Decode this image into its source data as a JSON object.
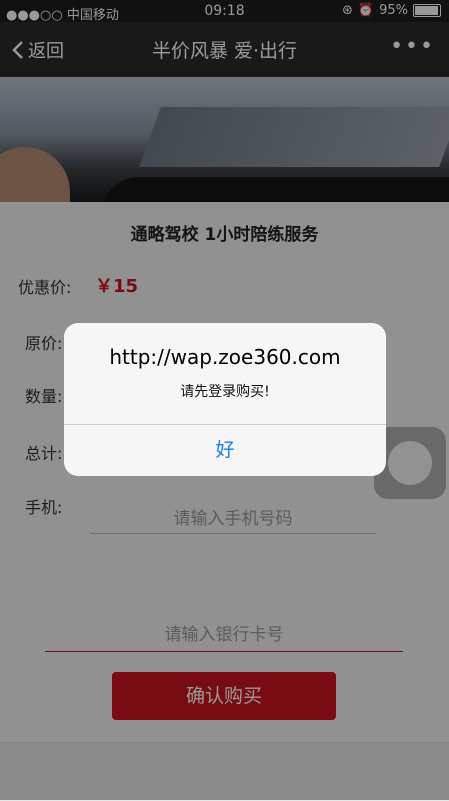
{
  "status": {
    "carrier": "●●●○○ 中国移动",
    "time": "09:18",
    "battery": "95%",
    "battery_level": 0.95
  },
  "nav": {
    "back": "返回",
    "title": "半价风暴 爱·出行",
    "more": "•••"
  },
  "product": {
    "title": "通略驾校 1小时陪练服务",
    "promo_label": "优惠价:",
    "promo_price": "￥15",
    "original_label": "原价:",
    "quantity_label": "数量:",
    "total_label": "总计:",
    "phone_label": "手机:",
    "phone_placeholder": "请输入手机号码",
    "card_placeholder": "请输入银行卡号",
    "confirm": "确认购买"
  },
  "alert": {
    "title": "http://wap.zoe360.com",
    "message": "请先登录购买!",
    "ok": "好"
  }
}
